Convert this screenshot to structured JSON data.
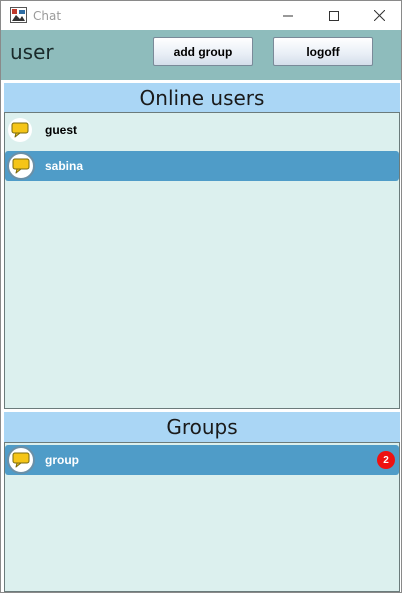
{
  "window": {
    "title": "Chat"
  },
  "header": {
    "username": "user",
    "add_group_label": "add group",
    "logoff_label": "logoff"
  },
  "online_users": {
    "title": "Online users",
    "items": [
      {
        "name": "guest",
        "selected": false,
        "icon": "chat-bubble-icon"
      },
      {
        "name": "sabina",
        "selected": true,
        "icon": "chat-bubble-icon"
      }
    ]
  },
  "groups": {
    "title": "Groups",
    "items": [
      {
        "name": "group",
        "selected": true,
        "unread": "2",
        "icon": "chat-bubble-icon"
      }
    ]
  },
  "colors": {
    "header_bg": "#8ebcbc",
    "section_header_bg": "#aad6f5",
    "list_bg": "#dcf0ee",
    "selected_row": "#4f9cc8",
    "badge": "#ee1111",
    "bubble": "#f5c518"
  }
}
